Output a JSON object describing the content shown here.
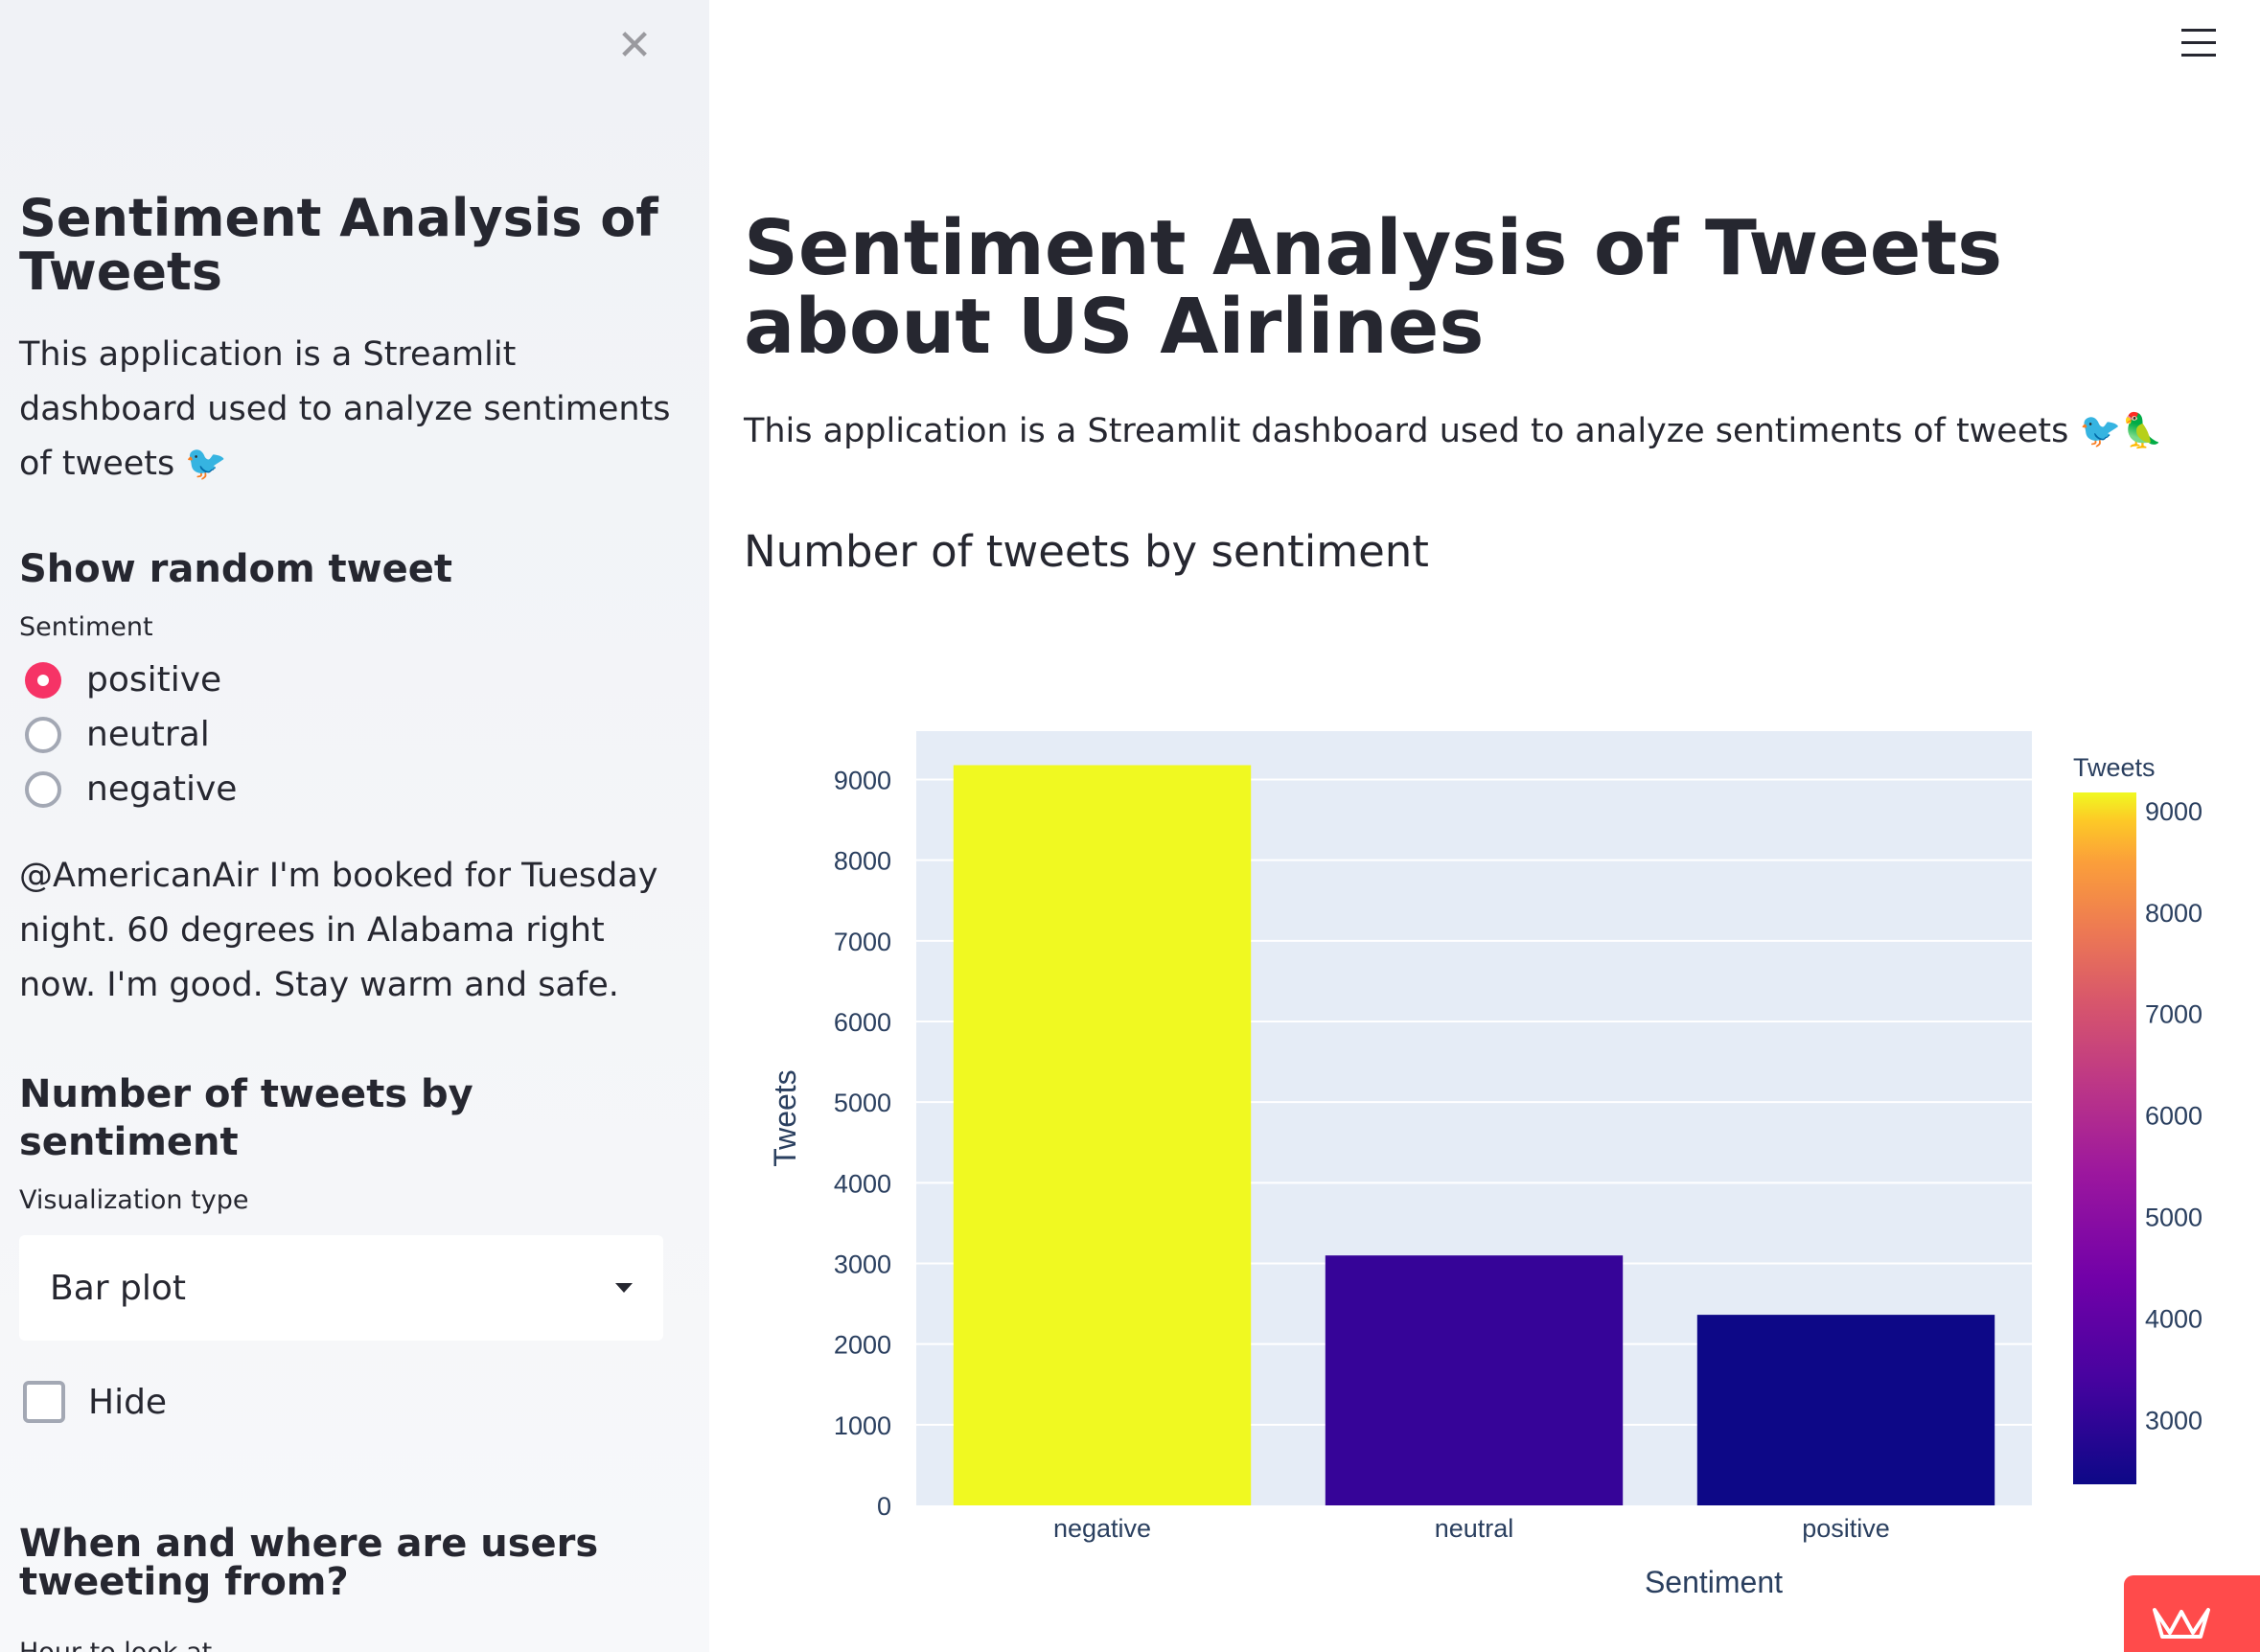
{
  "sidebar": {
    "title": "Sentiment Analysis of Tweets",
    "description": "This application is a Streamlit dashboard used to analyze sentiments of tweets 🐦",
    "random_tweet": {
      "heading": "Show random tweet",
      "radio_label": "Sentiment",
      "options": [
        "positive",
        "neutral",
        "negative"
      ],
      "selected": "positive",
      "tweet_text": "@AmericanAir I'm booked for Tuesday night. 60 degrees in Alabama right now. I'm good. Stay warm and safe."
    },
    "count_section": {
      "heading": "Number of tweets by sentiment",
      "select_label": "Visualization type",
      "select_value": "Bar plot",
      "hide_label": "Hide"
    },
    "location_section": {
      "heading": "When and where are users tweeting from?",
      "hour_label": "Hour to look at"
    }
  },
  "main": {
    "title": "Sentiment Analysis of Tweets about US Airlines",
    "description": "This application is a Streamlit dashboard used to analyze sentiments of tweets 🐦🦜",
    "chart_heading": "Number of tweets by sentiment"
  },
  "icons": {
    "close": "close-icon",
    "menu": "hamburger-menu-icon",
    "select": "chevron-down-icon",
    "deploy": "streamlit-crown-icon"
  },
  "colors": {
    "accent": "#f63366",
    "sidebar_bg": "#f0f2f6",
    "plot_bg": "#e5ecf6",
    "text": "#262730"
  },
  "chart_data": {
    "type": "bar",
    "categories": [
      "negative",
      "neutral",
      "positive"
    ],
    "values": [
      9178,
      3099,
      2363
    ],
    "xlabel": "Sentiment",
    "ylabel": "Tweets",
    "ylim": [
      0,
      9600
    ],
    "yticks": [
      0,
      1000,
      2000,
      3000,
      4000,
      5000,
      6000,
      7000,
      8000,
      9000
    ],
    "colorbar": {
      "title": "Tweets",
      "range": [
        2363,
        9178
      ],
      "ticks": [
        3000,
        4000,
        5000,
        6000,
        7000,
        8000,
        9000
      ]
    },
    "grid": true
  }
}
